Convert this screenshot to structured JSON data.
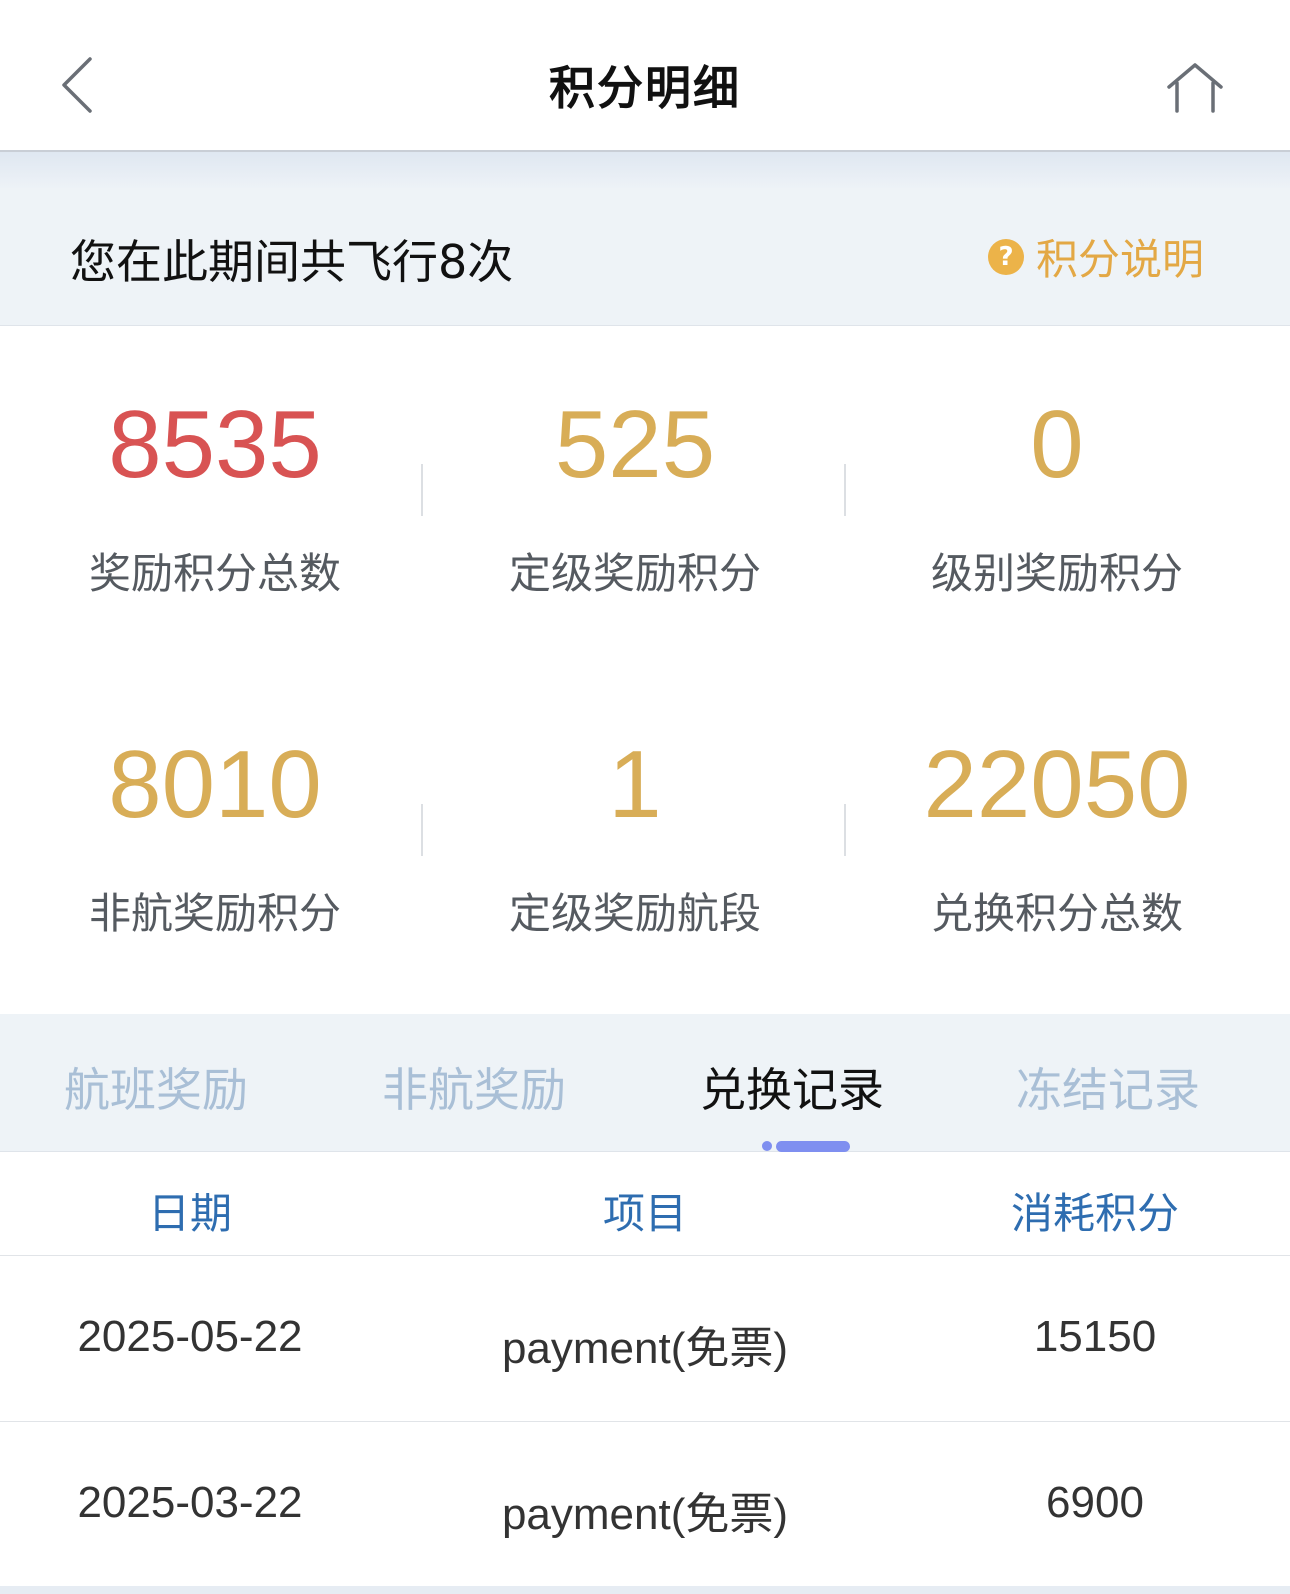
{
  "navbar": {
    "title": "积分明细",
    "back_icon": "chevron-left-icon",
    "home_icon": "home-icon"
  },
  "summary": {
    "text": "您在此期间共飞行8次",
    "info_label": "积分说明",
    "info_icon_glyph": "?"
  },
  "stats": [
    {
      "value": "8535",
      "label": "奖励积分总数",
      "color": "#d85353"
    },
    {
      "value": "525",
      "label": "定级奖励积分",
      "color": "#d8ad57"
    },
    {
      "value": "0",
      "label": "级别奖励积分",
      "color": "#d8ad57"
    },
    {
      "value": "8010",
      "label": "非航奖励积分",
      "color": "#d8ad57"
    },
    {
      "value": "1",
      "label": "定级奖励航段",
      "color": "#d8ad57"
    },
    {
      "value": "22050",
      "label": "兑换积分总数",
      "color": "#d8ad57"
    }
  ],
  "tabs": [
    {
      "label": "航班奖励",
      "active": false
    },
    {
      "label": "非航奖励",
      "active": false
    },
    {
      "label": "兑换记录",
      "active": true
    },
    {
      "label": "冻结记录",
      "active": false
    }
  ],
  "table": {
    "headers": [
      "日期",
      "项目",
      "消耗积分"
    ],
    "rows": [
      [
        "2025-05-22",
        "payment(免票)",
        "15150"
      ],
      [
        "2025-03-22",
        "payment(免票)",
        "6900"
      ]
    ]
  },
  "colors": {
    "accent_gold": "#d8ad57",
    "accent_red": "#d85353",
    "header_blue": "#2e6db0",
    "tab_inactive": "#a9bfd6",
    "tab_indicator": "#7f8ff0"
  }
}
